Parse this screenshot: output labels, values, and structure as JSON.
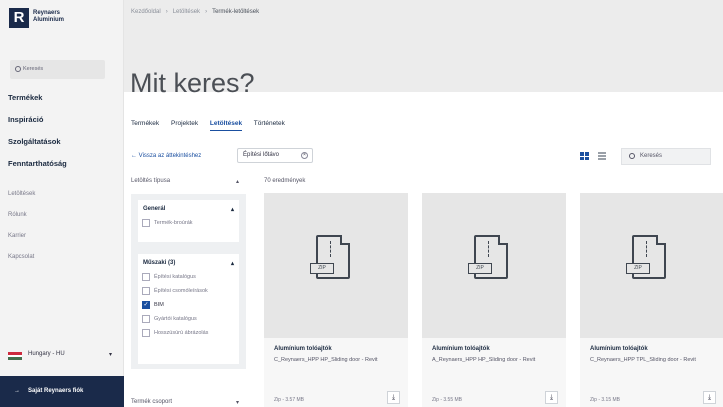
{
  "brand": {
    "logo_letter": "R",
    "name_line1": "Reynaers",
    "name_line2": "Aluminium"
  },
  "sidebar": {
    "search_label": "Keresés",
    "main_items": [
      {
        "label": "Termékek"
      },
      {
        "label": "Inspiráció"
      },
      {
        "label": "Szolgáltatások"
      },
      {
        "label": "Fenntarthatóság"
      }
    ],
    "sub_items": [
      {
        "label": "Letöltések"
      },
      {
        "label": "Rólunk"
      },
      {
        "label": "Karrier"
      },
      {
        "label": "Kapcsolat"
      }
    ],
    "language": "Hungary - HU",
    "cta": "Saját Reynaers fiók"
  },
  "breadcrumb": {
    "items": [
      "Kezdőoldal",
      "Letöltések"
    ],
    "current": "Termék-letöltések"
  },
  "page_title": "Mit keres?",
  "tabs": [
    {
      "label": "Termékek",
      "active": false
    },
    {
      "label": "Projektek",
      "active": false
    },
    {
      "label": "Letöltések",
      "active": true
    },
    {
      "label": "Történetek",
      "active": false
    }
  ],
  "toolbar": {
    "back_link": "Vissza az áttekintéshez",
    "active_filter": "Építési lőtávo",
    "search_placeholder": "Keresés"
  },
  "filters": {
    "header": "Letöltés típusa",
    "results": "70 eredmények",
    "groups": [
      {
        "title": "Generál",
        "options": [
          {
            "label": "Termék-broúrák",
            "checked": false
          }
        ]
      },
      {
        "title": "Műszaki (3)",
        "options": [
          {
            "label": "Építési katalógus",
            "checked": false
          },
          {
            "label": "Építési csomóleírások",
            "checked": false
          },
          {
            "label": "BIM",
            "checked": true
          },
          {
            "label": "Gyártói katalógus",
            "checked": false
          },
          {
            "label": "Hosszúsúrú ábrázolás",
            "checked": false
          }
        ]
      }
    ],
    "footer": "Termék csoport"
  },
  "cards": [
    {
      "category": "Alumínium tolóajtók",
      "name": "C_Reynaers_HPP HP_Sliding door - Revit",
      "size": "Zip - 3.57 MB",
      "file_type": "ZIP"
    },
    {
      "category": "Alumínium tolóajtók",
      "name": "A_Reynaers_HPP HP_Sliding door - Revit",
      "size": "Zip - 3.55 MB",
      "file_type": "ZIP"
    },
    {
      "category": "Alumínium tolóajtók",
      "name": "C_Reynaers_HPP TPL_Sliding door - Revit",
      "size": "Zip - 3.15 MB",
      "file_type": "ZIP"
    }
  ],
  "colors": {
    "brand_navy": "#1a2a4a",
    "accent_blue": "#1a4fa0"
  }
}
